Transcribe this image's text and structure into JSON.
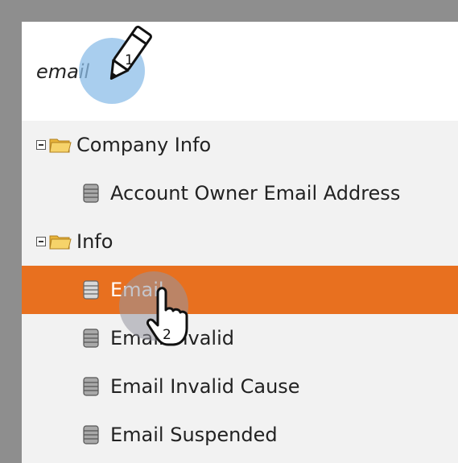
{
  "search": {
    "value": "email",
    "step_marker": "1"
  },
  "tree": {
    "groups": [
      {
        "label": "Company Info",
        "fields": [
          "Account Owner Email Address"
        ]
      },
      {
        "label": "Info",
        "fields": [
          "Email",
          "Email Invalid",
          "Email Invalid Cause",
          "Email Suspended"
        ]
      }
    ],
    "selected_field": "Email",
    "click_marker": "2"
  },
  "colors": {
    "selection": "#e8701f",
    "callout": "#8cbee8",
    "folder": "#f0c24a"
  },
  "icons": {
    "folder": "folder-icon",
    "field": "database-icon",
    "expand": "collapse-minus-icon",
    "pencil": "pencil-icon",
    "cursor": "hand-cursor-icon"
  }
}
